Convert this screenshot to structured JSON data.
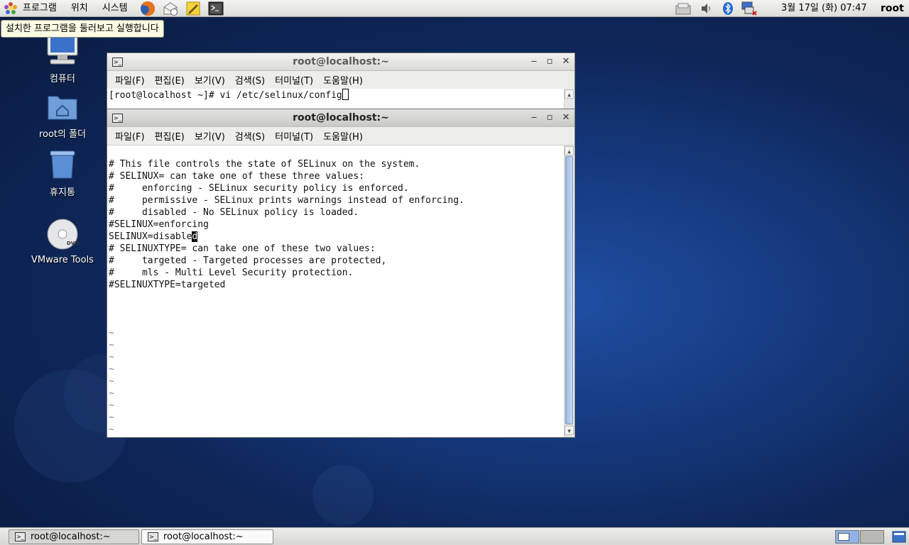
{
  "top_panel": {
    "menus": [
      "프로그램",
      "위치",
      "시스템"
    ],
    "clock": "3월 17일 (화) 07:47",
    "user": "root"
  },
  "tooltip": "설치한 프로그램을 둘러보고 실행합니다",
  "desktop_icons": [
    {
      "label": "컴퓨터",
      "icon": "computer-icon"
    },
    {
      "label": "root의 폴더",
      "icon": "home-folder-icon"
    },
    {
      "label": "휴지통",
      "icon": "trash-icon"
    },
    {
      "label": "VMware Tools",
      "icon": "dvd-icon"
    }
  ],
  "window_back": {
    "title": "root@localhost:~",
    "menu": [
      "파일(F)",
      "편집(E)",
      "보기(V)",
      "검색(S)",
      "터미널(T)",
      "도움말(H)"
    ],
    "prompt": "[root@localhost ~]# vi /etc/selinux/config"
  },
  "window_front": {
    "title": "root@localhost:~",
    "menu": [
      "파일(F)",
      "편집(E)",
      "보기(V)",
      "검색(S)",
      "터미널(T)",
      "도움말(H)"
    ],
    "lines": [
      "",
      "# This file controls the state of SELinux on the system.",
      "# SELINUX= can take one of these three values:",
      "#     enforcing - SELinux security policy is enforced.",
      "#     permissive - SELinux prints warnings instead of enforcing.",
      "#     disabled - No SELinux policy is loaded.",
      "#SELINUX=enforcing",
      "SELINUX=disabled",
      "# SELINUXTYPE= can take one of these two values:",
      "#     targeted - Targeted processes are protected,",
      "#     mls - Multi Level Security protection.",
      "#SELINUXTYPE=targeted",
      "",
      "",
      "",
      "~",
      "~",
      "~",
      "~",
      "~",
      "~",
      "~",
      "~",
      "~"
    ]
  },
  "taskbar": {
    "buttons": [
      "root@localhost:~",
      "root@localhost:~"
    ]
  }
}
